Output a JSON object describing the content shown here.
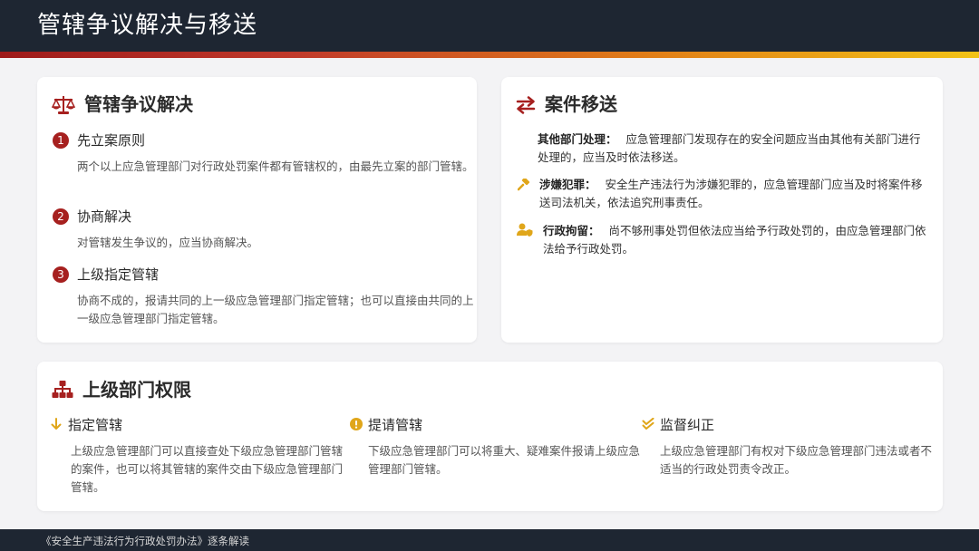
{
  "header": {
    "title": "管辖争议解决与移送"
  },
  "dispute": {
    "title": "管辖争议解决",
    "icon": "scale-icon",
    "items": [
      {
        "num": "1",
        "title": "先立案原则",
        "desc": "两个以上应急管理部门对行政处罚案件都有管辖权的，由最先立案的部门管辖。"
      },
      {
        "num": "2",
        "title": "协商解决",
        "desc": "对管辖发生争议的，应当协商解决。"
      },
      {
        "num": "3",
        "title": "上级指定管辖",
        "desc": "协商不成的，报请共同的上一级应急管理部门指定管辖；也可以直接由共同的上一级应急管理部门指定管辖。"
      }
    ]
  },
  "transfer": {
    "title": "案件移送",
    "icon": "swap-arrows-icon",
    "items": [
      {
        "label": "其他部门处理：",
        "text": "应急管理部门发现存在的安全问题应当由其他有关部门进行处理的，应当及时依法移送。",
        "icon": ""
      },
      {
        "label": "涉嫌犯罪：",
        "text": "安全生产违法行为涉嫌犯罪的，应急管理部门应当及时将案件移送司法机关，依法追究刑事责任。",
        "icon": "gavel-icon"
      },
      {
        "label": "行政拘留：",
        "text": "尚不够刑事处罚但依法应当给予行政处罚的，由应急管理部门依法给予行政处罚。",
        "icon": "user-shield-icon"
      }
    ]
  },
  "superior": {
    "title": "上级部门权限",
    "icon": "org-chart-icon",
    "items": [
      {
        "title": "指定管辖",
        "icon": "arrow-down-icon",
        "desc": "上级应急管理部门可以直接查处下级应急管理部门管辖的案件，也可以将其管辖的案件交由下级应急管理部门管辖。"
      },
      {
        "title": "提请管辖",
        "icon": "exclamation-circle-icon",
        "desc": "下级应急管理部门可以将重大、疑难案件报请上级应急管理部门管辖。"
      },
      {
        "title": "监督纠正",
        "icon": "double-check-icon",
        "desc": "上级应急管理部门有权对下级应急管理部门违法或者不适当的行政处罚责令改正。"
      }
    ]
  },
  "footer": {
    "text": "《安全生产违法行为行政处罚办法》逐条解读"
  },
  "colors": {
    "accent": "#a6201f",
    "dark": "#1e2632",
    "gold": "#e0a61a"
  }
}
